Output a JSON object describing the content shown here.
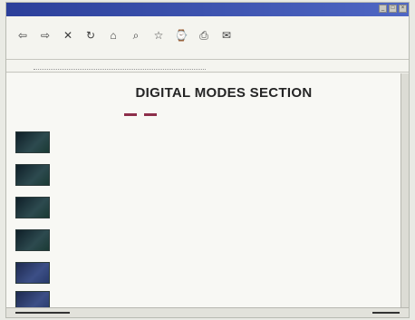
{
  "window": {
    "title": "",
    "controls": [
      "_",
      "□",
      "×"
    ]
  },
  "menubar": {
    "items": []
  },
  "toolbar": {
    "buttons": []
  },
  "addressbar": {
    "label": "",
    "value": "",
    "links_label": "",
    "links_value": ""
  },
  "page": {
    "heading": "DIGITAL MODES SECTION",
    "subheading": ""
  },
  "rows": [
    {
      "text": "",
      "thumb": "dark"
    },
    {
      "text": "",
      "thumb": "dark"
    },
    {
      "text": "",
      "thumb": "dark"
    },
    {
      "text": "",
      "thumb": "dark"
    },
    {
      "text": "",
      "thumb": "blue"
    },
    {
      "text": "",
      "thumb": "blue"
    }
  ],
  "colors": {
    "titlebar": "#2b3f9a",
    "accent": "#8d2f4a",
    "background": "#f8f8f4"
  }
}
